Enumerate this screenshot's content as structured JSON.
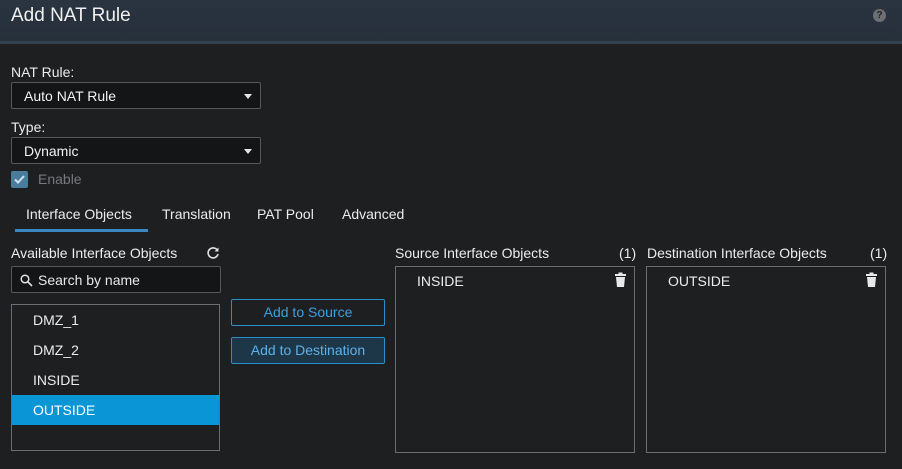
{
  "dialog": {
    "title": "Add NAT Rule"
  },
  "nat_rule": {
    "label": "NAT Rule:",
    "value": "Auto NAT Rule"
  },
  "type": {
    "label": "Type:",
    "value": "Dynamic"
  },
  "enable": {
    "label": "Enable",
    "checked": true
  },
  "tabs": [
    {
      "label": "Interface Objects",
      "active": true
    },
    {
      "label": "Translation",
      "active": false
    },
    {
      "label": "PAT Pool",
      "active": false
    },
    {
      "label": "Advanced",
      "active": false
    }
  ],
  "available": {
    "title": "Available Interface Objects",
    "search_placeholder": "Search by name",
    "items": [
      {
        "label": "DMZ_1",
        "selected": false
      },
      {
        "label": "DMZ_2",
        "selected": false
      },
      {
        "label": "INSIDE",
        "selected": false
      },
      {
        "label": "OUTSIDE",
        "selected": true
      }
    ]
  },
  "buttons": {
    "add_source": "Add to Source",
    "add_destination": "Add to Destination"
  },
  "source": {
    "title": "Source Interface Objects",
    "count": "(1)",
    "items": [
      "INSIDE"
    ]
  },
  "destination": {
    "title": "Destination Interface Objects",
    "count": "(1)",
    "items": [
      "OUTSIDE"
    ]
  },
  "colors": {
    "accent": "#0a96d6",
    "tab_underline": "#3a87c2",
    "button_border": "#2a8fcd"
  }
}
